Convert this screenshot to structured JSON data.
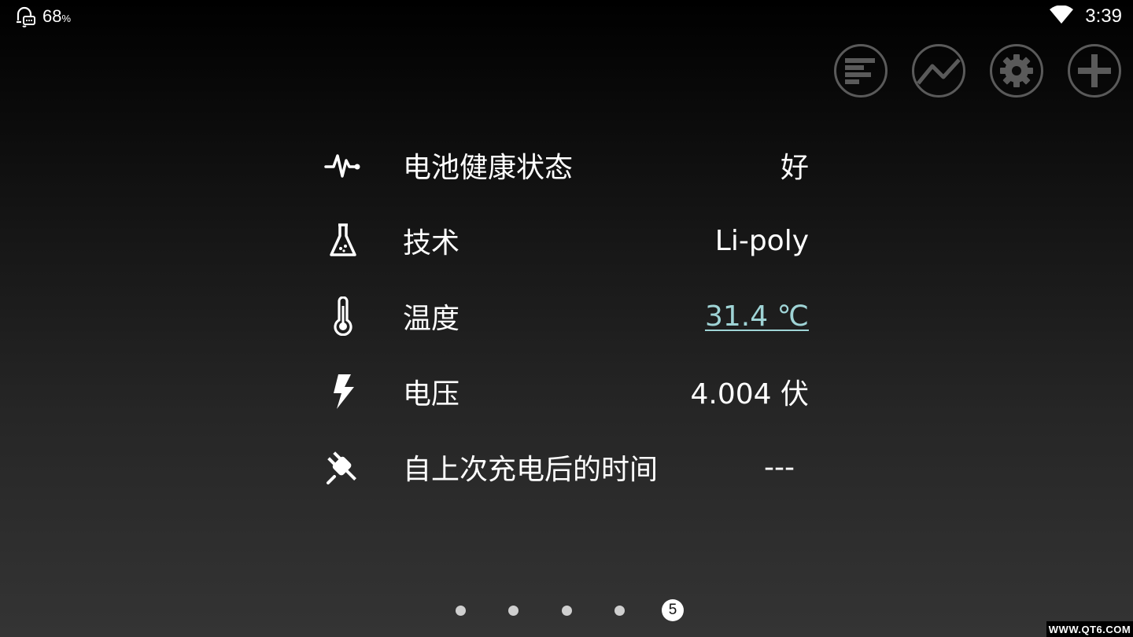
{
  "status_bar": {
    "battery_percent": "68",
    "battery_percent_sign": "%",
    "time": "3:39",
    "left_icon": "notification-bell-chat-icon",
    "right_icon": "wifi-icon"
  },
  "toolbar": {
    "buttons": [
      {
        "name": "list-button",
        "icon": "bar-list-icon"
      },
      {
        "name": "chart-button",
        "icon": "line-chart-icon"
      },
      {
        "name": "settings-button",
        "icon": "gear-icon"
      },
      {
        "name": "add-button",
        "icon": "plus-icon"
      }
    ]
  },
  "info": {
    "rows": [
      {
        "icon": "pulse-icon",
        "label": "电池健康状态",
        "value": "好"
      },
      {
        "icon": "flask-icon",
        "label": "技术",
        "value": "Li-poly"
      },
      {
        "icon": "thermometer-icon",
        "label": "温度",
        "value": "31.4 ℃"
      },
      {
        "icon": "lightning-icon",
        "label": "电压",
        "value": "4.004 伏"
      },
      {
        "icon": "plug-icon",
        "label": "自上次充电后的时间",
        "value": "---"
      }
    ]
  },
  "pager": {
    "total": 5,
    "active_label": "5"
  },
  "watermark": {
    "text": "WWW.QT6.COM"
  },
  "colors": {
    "link_value": "#9fd4d6",
    "button_border": "#5a5a5a",
    "text": "#ffffff"
  }
}
